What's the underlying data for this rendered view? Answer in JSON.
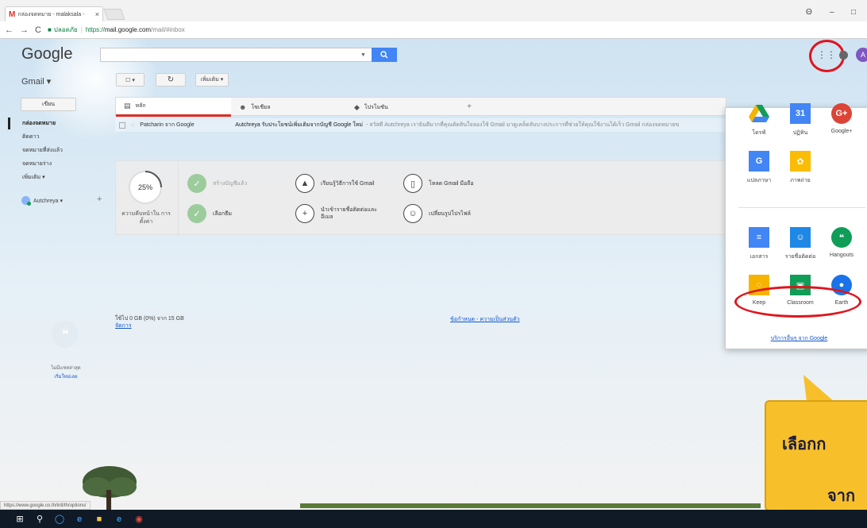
{
  "browser": {
    "tab_title": "กล่องจดหมาย - malaksala - ",
    "tab_close": "×",
    "secure_label": "ปลอดภัย",
    "url_proto": "https://",
    "url_host": "mail.google.com",
    "url_path": "/mail/#inbox",
    "status_url": "https://www.google.co.th/intl/th/options/",
    "window_controls": [
      "Θ",
      "–",
      "□"
    ]
  },
  "header": {
    "logo": "Google",
    "search_button_icon": "search-icon",
    "apps_icon": "apps-grid-icon",
    "avatar_letter": "A"
  },
  "toolbar": {
    "gmail_label": "Gmail ▾",
    "select_label": "☐ ▾",
    "refresh_icon": "↻",
    "more_label": "เพิ่มเติม ▾"
  },
  "sidebar": {
    "compose_label": "เขียน",
    "items": [
      {
        "label": "กล่องจดหมาย",
        "active": true
      },
      {
        "label": "ติดดาว",
        "active": false
      },
      {
        "label": "จดหมายที่ส่งแล้ว",
        "active": false
      },
      {
        "label": "จดหมายร่าง",
        "active": false
      },
      {
        "label": "เพิ่มเติม ▾",
        "active": false
      }
    ],
    "chat_user": "Autchreya ▾",
    "chat_plus": "+",
    "no_chat_line1": "ไม่มีแชทล่าสุด",
    "no_chat_line2": "เริ่มใหม่เลย"
  },
  "inbox": {
    "tabs": [
      {
        "label": "หลัก",
        "icon": "inbox-icon"
      },
      {
        "label": "โซเชียล",
        "icon": "people-icon"
      },
      {
        "label": "โปรโมชัน",
        "icon": "tag-icon"
      }
    ],
    "add_tab": "+",
    "message": {
      "sender": "Patcharin จาก Google",
      "subject": "Autchreya รับประโยชน์เพิ่มเติมจากบัญชี Google ใหม่",
      "snippet": " - สวัสดี Autchreya เรายินดีมากที่คุณตัดสินใจลองใช้ Gmail มาดูเคล็ดลับบางประการที่ช่วยให้คุณใช้งานได้เร็ว Gmail กล่องจดหมายข"
    },
    "setup": {
      "progress": 0.25,
      "progress_text": "25%",
      "progress_label": "ความคืบหน้าใน การตั้งค่า",
      "tasks": [
        {
          "label": "สร้างบัญชีแล้ว",
          "icon": "check-icon",
          "done": true
        },
        {
          "label": "เลือกธีม",
          "icon": "check-icon",
          "done": true
        },
        {
          "label": "เรียนรู้วิธีการใช้ Gmail",
          "icon": "graduation-cap-icon",
          "done": false
        },
        {
          "label": "นำเข้ารายชื่อติดต่อและ อีเมล",
          "icon": "add-person-icon",
          "done": false
        },
        {
          "label": "โหลด Gmail มือถือ",
          "icon": "phone-icon",
          "done": false
        },
        {
          "label": "เปลี่ยนรูปโปรไฟล์",
          "icon": "profile-icon",
          "done": false
        }
      ]
    },
    "storage_text": "ใช้ไป 0 GB (0%) จาก 15 GB",
    "manage_link": "จัดการ",
    "terms_link": "ข้อกำหนด - ความเป็นส่วนตัว"
  },
  "apps_popup": {
    "apps": [
      {
        "name": "ไดรฟ์",
        "icon": "drive-icon",
        "color": "#f4b400"
      },
      {
        "name": "ปฏิทิน",
        "icon": "calendar-icon",
        "color": "#4285f4",
        "glyph": "31"
      },
      {
        "name": "Google+",
        "icon": "google-plus-icon",
        "color": "#db4437",
        "glyph": "G+"
      },
      {
        "name": "แปลภาษา",
        "icon": "translate-icon",
        "color": "#4285f4",
        "glyph": "G"
      },
      {
        "name": "ภาพถ่าย",
        "icon": "photos-icon",
        "color": "#fbbc05",
        "glyph": "✿"
      },
      {
        "name": "เอกสาร",
        "icon": "docs-icon",
        "color": "#4285f4",
        "glyph": "≡"
      },
      {
        "name": "รายชื่อติดต่อ",
        "icon": "contacts-icon",
        "color": "#1e88e5",
        "glyph": "☺"
      },
      {
        "name": "Hangouts",
        "icon": "hangouts-icon",
        "color": "#0f9d58",
        "glyph": "❝"
      },
      {
        "name": "Keep",
        "icon": "keep-icon",
        "color": "#f6b400",
        "glyph": "◌"
      },
      {
        "name": "Classroom",
        "icon": "classroom-icon",
        "color": "#0f9d58",
        "glyph": "▣"
      },
      {
        "name": "Earth",
        "icon": "earth-icon",
        "color": "#1a73e8",
        "glyph": "●"
      }
    ],
    "more_link": "บริการอื่นๆ จาก Google"
  },
  "annotation": {
    "line1": "เลือกก",
    "line2": "จาก",
    "ring_color": "#e0141e",
    "callout_color": "#f7c02a"
  },
  "taskbar": {
    "items": [
      "windows-start-icon",
      "search-icon",
      "cortana-icon",
      "edge-icon",
      "file-explorer-icon",
      "ie-icon",
      "chrome-icon"
    ]
  }
}
